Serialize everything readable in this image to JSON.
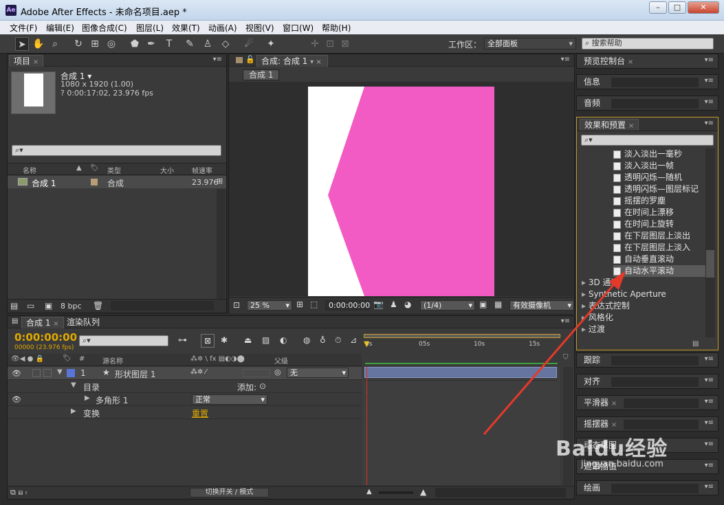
{
  "window": {
    "title": "Adobe After Effects - 未命名项目.aep *",
    "logo": "Ae",
    "minimize": "–",
    "maximize": "□",
    "close": "✕"
  },
  "menu": [
    "文件(F)",
    "编辑(E)",
    "图像合成(C)",
    "图层(L)",
    "效果(T)",
    "动画(A)",
    "视图(V)",
    "窗口(W)",
    "帮助(H)"
  ],
  "toolbar": {
    "workspace_label": "工作区：",
    "workspace_value": "全部面板",
    "search_placeholder": "搜索帮助"
  },
  "project": {
    "tab": "项目",
    "comp_name": "合成 1",
    "comp_dims": "1080 x 1920 (1.00)",
    "comp_info": "? 0:00:17:02, 23.976 fps",
    "columns": [
      "名称",
      "类型",
      "大小",
      "帧速率"
    ],
    "rows": [
      {
        "name": "合成 1",
        "type": "合成",
        "size": "",
        "fps": "23.976"
      }
    ],
    "bpc": "8 bpc"
  },
  "composition": {
    "tab": "合成: 合成 1",
    "subtab": "合成 1",
    "zoom": "25 %",
    "timecode": "0:00:00:00",
    "resolution": "(1/4)",
    "camera": "有效摄像机",
    "colors": {
      "background": "#ffffff",
      "shape": "#f25bc4"
    }
  },
  "right_panels": {
    "preview": "预览控制台",
    "info": "信息",
    "audio": "音频",
    "effects": "效果和预置",
    "tracker": "跟踪",
    "align": "对齐",
    "smoother": "平滑器",
    "wiggler": "摇摆器",
    "motion_sketch": "动态草图",
    "mask_interp": "遮罩插值",
    "paint": "绘画"
  },
  "effects_list": [
    "淡入淡出一毫秒",
    "淡入淡出一帧",
    "透明闪烁—随机",
    "透明闪烁—图层标记",
    "摇摆的罗塵",
    "在时间上漂移",
    "在时间上旋转",
    "在下层图层上淡出",
    "在下层图层上淡入",
    "自动垂直滚动",
    "自动水平滚动"
  ],
  "effects_categories": [
    "3D 通道",
    "Synthetic Aperture",
    "表达式控制",
    "风格化",
    "过渡"
  ],
  "timeline": {
    "tab": "合成 1",
    "render_tab": "渲染队列",
    "timecode": "0:00:00:00",
    "frames": "00000 (23.976 fps)",
    "columns": {
      "source": "源名称",
      "parent": "父级"
    },
    "layer": {
      "num": "1",
      "name": "形状图层 1",
      "parent": "无"
    },
    "contents": "目录",
    "add": "添加:",
    "polygon": "多角形 1",
    "blend": "正常",
    "transform": "变换",
    "reset": "重置",
    "ruler": [
      "0s",
      "05s",
      "10s",
      "15s"
    ],
    "toggle": "切换开关 / 模式"
  },
  "watermark": {
    "brand": "Baidu经验",
    "url": "jingyan.baidu.com"
  }
}
